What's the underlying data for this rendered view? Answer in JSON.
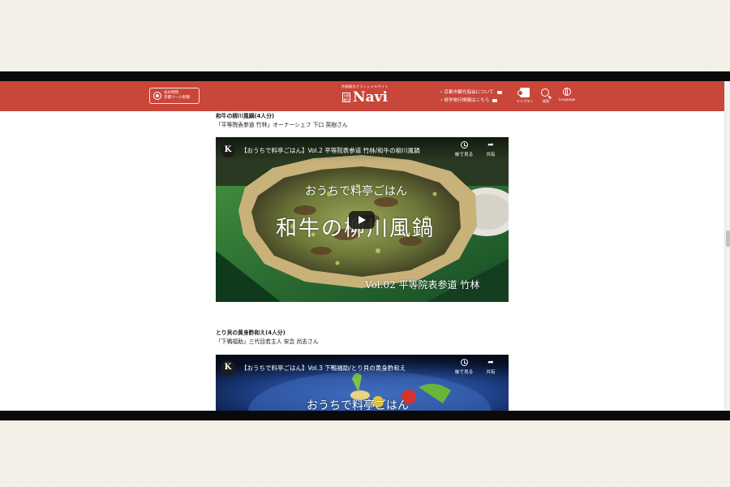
{
  "header": {
    "left_button_label": "光の明暗\n京都ツール制限",
    "logo_subtitle": "京都観光オフィシャルサイト",
    "logo_stamp": "京都観光",
    "logo_text": "Navi",
    "links": [
      "京都市観光協会について",
      "修学旅行情報はこちら"
    ],
    "icons": [
      {
        "name": "myplan-icon",
        "label": "マイプラン"
      },
      {
        "name": "search-icon",
        "label": "検索"
      },
      {
        "name": "globe-icon",
        "label": "Language"
      }
    ]
  },
  "sections": [
    {
      "title": "和牛の柳川風鍋(4人分)",
      "chef": "「平等院表参道 竹林」オーナーシェフ 下口 英樹さん",
      "video": {
        "channel_logo": "K",
        "title": "【おうちで料亭ごはん】Vol.2 平等院表参道 竹林/和牛の柳川風鍋",
        "watch_later": "後で見る",
        "share": "共有",
        "overlay_line1": "おうちで料亭ごはん",
        "overlay_line2": "和牛の柳川風鍋",
        "overlay_line3": "Vol.02 平等院表参道 竹林"
      }
    },
    {
      "title": "とり貝の黄身酢和え(4人分)",
      "chef": "「下鴨福助」三代目若主人 安念 尚志さん",
      "video": {
        "channel_logo": "K",
        "title": "【おうちで料亭ごはん】Vol.3 下鴨福助/とり貝の黄身酢和え",
        "watch_later": "後で見る",
        "share": "共有",
        "overlay_line1": "おうちで料亭ごはん"
      }
    }
  ]
}
